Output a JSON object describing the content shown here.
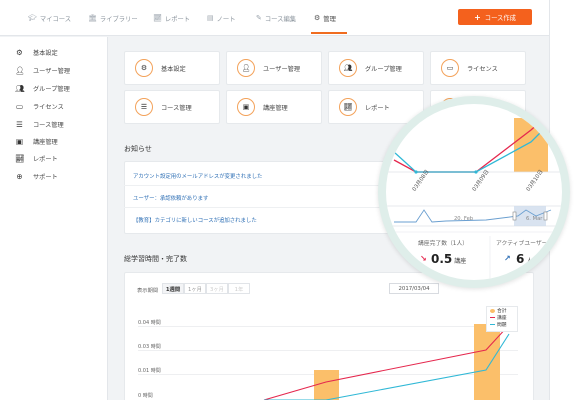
{
  "topnav": {
    "items": [
      {
        "label": "マイコース",
        "icon": "graduation-cap-icon"
      },
      {
        "label": "ライブラリー",
        "icon": "library-icon"
      },
      {
        "label": "レポート",
        "icon": "chart-icon"
      },
      {
        "label": "ノート",
        "icon": "notebook-icon"
      },
      {
        "label": "コース編集",
        "icon": "pencil-icon"
      },
      {
        "label": "管理",
        "icon": "gear-icon",
        "active": true
      }
    ],
    "create_button": "コース作成",
    "accent": "#f4611d"
  },
  "sidebar": {
    "items": [
      {
        "label": "基本設定",
        "icon": "gears-icon"
      },
      {
        "label": "ユーザー管理",
        "icon": "user-icon"
      },
      {
        "label": "グループ管理",
        "icon": "group-icon"
      },
      {
        "label": "ライセンス",
        "icon": "id-card-icon"
      },
      {
        "label": "コース管理",
        "icon": "list-icon"
      },
      {
        "label": "講座管理",
        "icon": "window-icon"
      },
      {
        "label": "レポート",
        "icon": "chart-icon"
      },
      {
        "label": "サポート",
        "icon": "lifebuoy-icon"
      }
    ]
  },
  "tiles": [
    {
      "label": "基本設定",
      "icon": "gears-icon"
    },
    {
      "label": "ユーザー管理",
      "icon": "user-icon"
    },
    {
      "label": "グループ管理",
      "icon": "group-icon"
    },
    {
      "label": "ライセンス",
      "icon": "id-card-icon"
    },
    {
      "label": "コース管理",
      "icon": "list-icon"
    },
    {
      "label": "講座管理",
      "icon": "window-icon"
    },
    {
      "label": "レポート",
      "icon": "chart-icon"
    }
  ],
  "notices": {
    "title": "お知らせ",
    "items": [
      "アカウント設定用のメールアドレスが変更されました",
      "ユーザー：承認依頼があります",
      "【教育】カテゴリに新しいコースが追加されました"
    ]
  },
  "study": {
    "title": "総学習時間・完了数",
    "display_label": "表示期間",
    "periods": [
      "1週間",
      "1ヶ月",
      "3ヶ月",
      "1年"
    ],
    "selected_period": "1週間",
    "date": "2017/03/04"
  },
  "chart_data": {
    "type": "bar",
    "categories": [
      "03月08日",
      "03月09日",
      "03月10日"
    ],
    "y_axis_labels": [
      "0.04 時間",
      "0.03 時間",
      "0.01 時間",
      "0 時間"
    ],
    "series": [
      {
        "name": "合計",
        "type": "bar",
        "color": "#fbbf6a"
      },
      {
        "name": "講座",
        "type": "line",
        "color": "#e5284e"
      },
      {
        "name": "問題",
        "type": "line",
        "color": "#30b8d6"
      }
    ],
    "legend_position": "top-right",
    "navigator_labels": [
      "20. Feb",
      "6. Mar"
    ]
  },
  "stats": {
    "completed_label": "講座完了数（1人）",
    "completed_value": "0.5",
    "completed_unit": "講座",
    "active_label": "アクティブユーザー",
    "active_value": "6",
    "active_unit": "人"
  }
}
